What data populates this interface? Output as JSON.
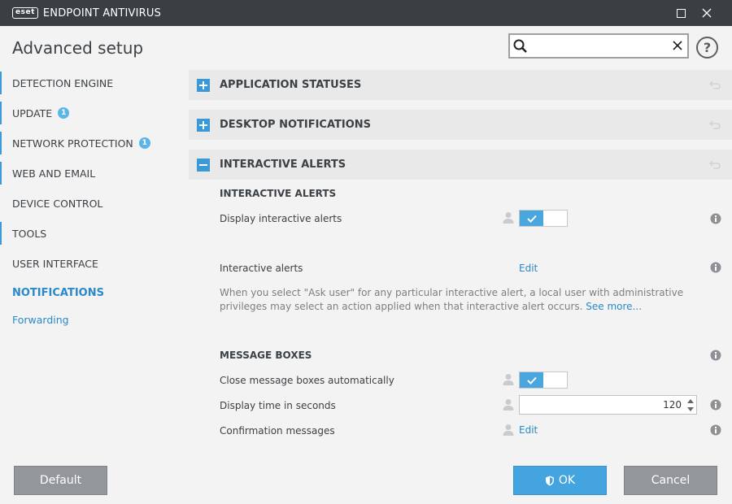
{
  "window": {
    "logo_text": "eset",
    "app_title": "ENDPOINT ANTIVIRUS"
  },
  "page_title": "Advanced setup",
  "search": {
    "value": "",
    "placeholder": ""
  },
  "help_label": "?",
  "sidebar": {
    "items": [
      {
        "label": "DETECTION ENGINE"
      },
      {
        "label": "UPDATE",
        "badge": "1"
      },
      {
        "label": "NETWORK PROTECTION",
        "badge": "1"
      },
      {
        "label": "WEB AND EMAIL"
      },
      {
        "label": "DEVICE CONTROL"
      },
      {
        "label": "TOOLS"
      },
      {
        "label": "USER INTERFACE"
      },
      {
        "label": "NOTIFICATIONS"
      },
      {
        "label": "Forwarding"
      }
    ]
  },
  "sections": [
    {
      "title": "APPLICATION STATUSES",
      "expanded": false
    },
    {
      "title": "DESKTOP NOTIFICATIONS",
      "expanded": false
    },
    {
      "title": "INTERACTIVE ALERTS",
      "expanded": true
    }
  ],
  "interactive_alerts": {
    "header": "INTERACTIVE ALERTS",
    "display_label": "Display interactive alerts",
    "display_enabled": true,
    "alerts_label": "Interactive alerts",
    "alerts_edit": "Edit",
    "description": "When you select \"Ask user\" for any particular interactive alert, a local user with administrative privileges may select an action applied when that interactive alert occurs.",
    "see_more": "See more..."
  },
  "message_boxes": {
    "header": "MESSAGE BOXES",
    "close_label": "Close message boxes automatically",
    "close_enabled": true,
    "time_label": "Display time in seconds",
    "time_value": "120",
    "confirm_label": "Confirmation messages",
    "confirm_edit": "Edit"
  },
  "buttons": {
    "default": "Default",
    "ok": "OK",
    "cancel": "Cancel"
  },
  "colors": {
    "accent": "#3a9ad9",
    "titlebar": "#3a3f44",
    "toggle_on": "#4aa6de"
  }
}
